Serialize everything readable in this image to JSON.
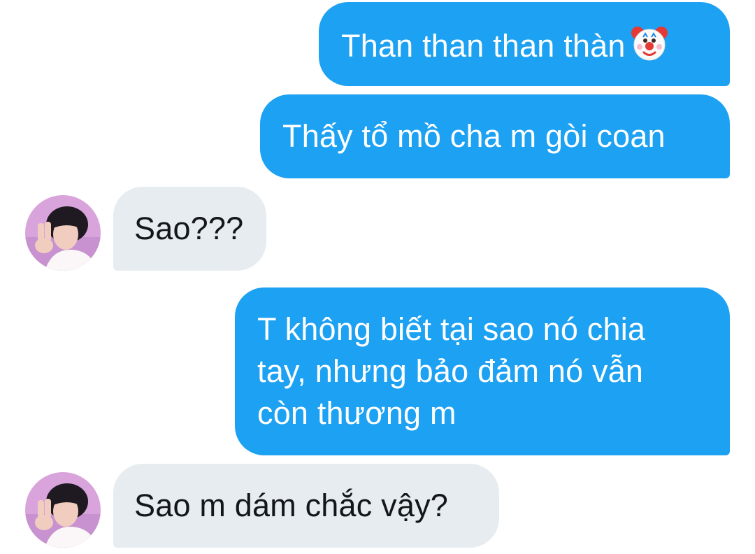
{
  "conversation": {
    "messages": [
      {
        "from": "me",
        "text": "Than than than thàn",
        "emoji": "clown-face-icon"
      },
      {
        "from": "me",
        "text": "Thấy tổ mồ cha m gòi coan"
      },
      {
        "from": "them",
        "text": "Sao???"
      },
      {
        "from": "me",
        "text": "T không biết tại sao nó chia tay, nhưng bảo đảm nó vẫn còn thương m"
      },
      {
        "from": "them",
        "text": "Sao m dám chắc vậy?"
      }
    ]
  },
  "colors": {
    "sent_bubble": "#1da1f2",
    "received_bubble": "#e6ecf0",
    "sent_text": "#ffffff",
    "received_text": "#14171a"
  }
}
